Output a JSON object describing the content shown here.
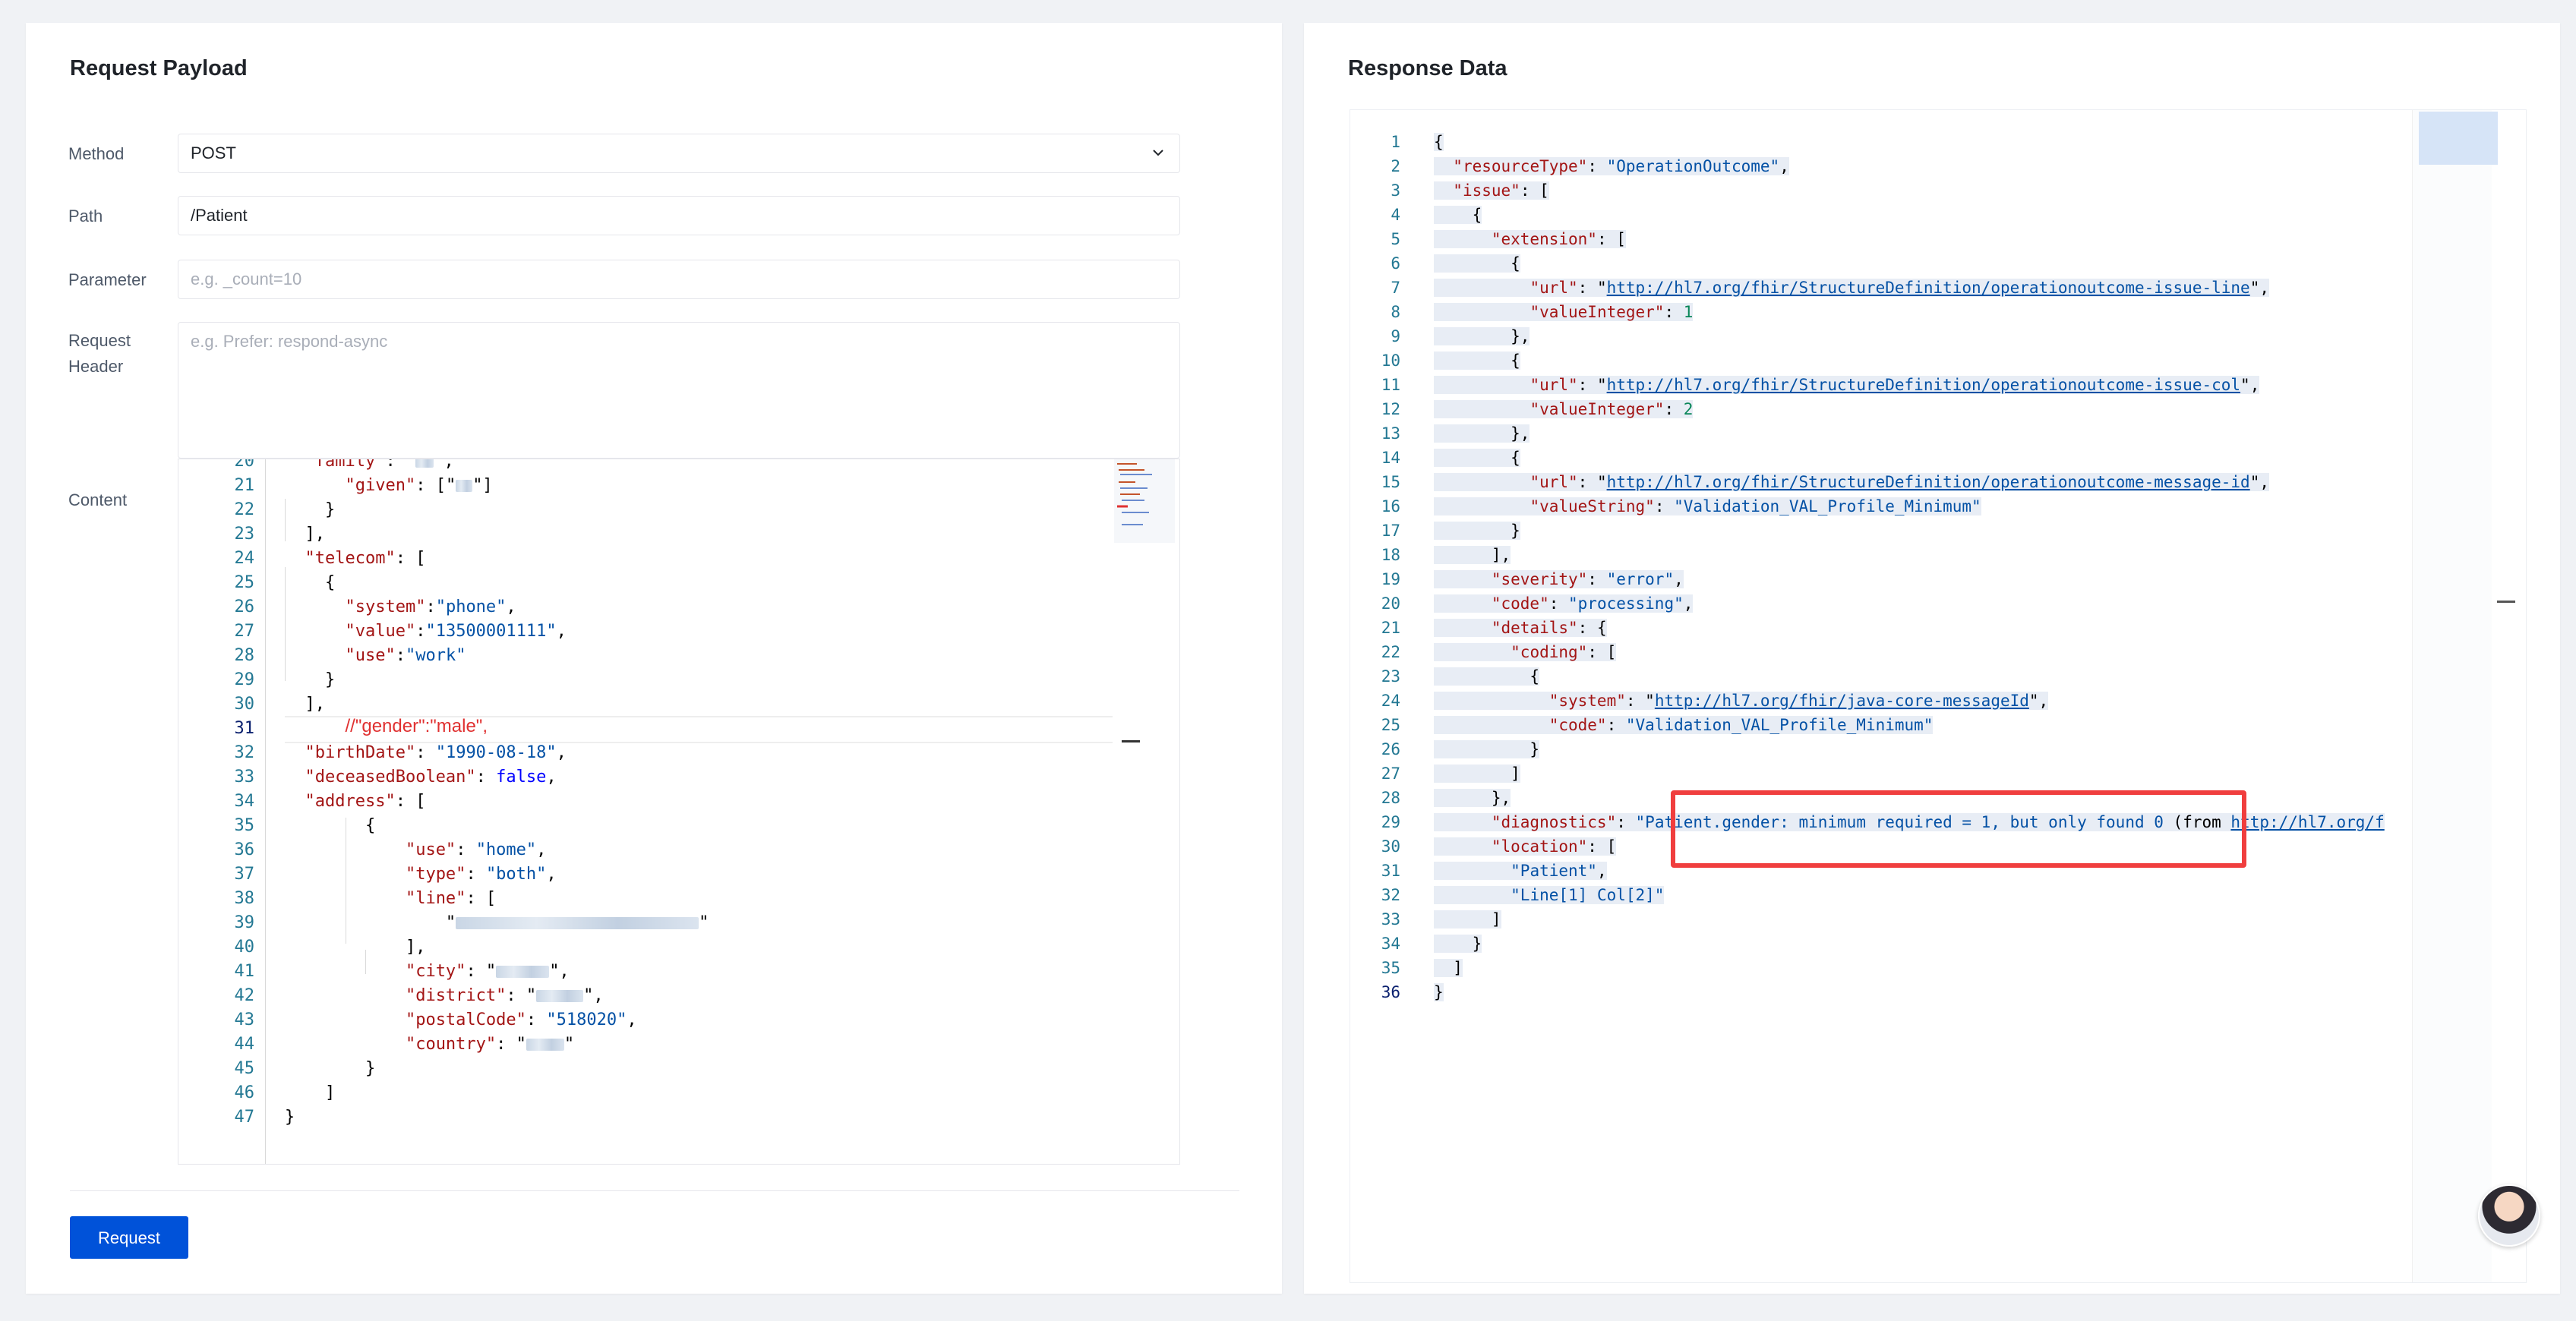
{
  "left": {
    "title": "Request Payload",
    "method_label": "Method",
    "method_value": "POST",
    "path_label": "Path",
    "path_value": "/Patient",
    "parameter_label": "Parameter",
    "parameter_placeholder": "e.g. _count=10",
    "header_label_1": "Request",
    "header_label_2": "Header",
    "header_placeholder": "e.g. Prefer: respond-async",
    "content_label": "Content",
    "request_button": "Request"
  },
  "right": {
    "title": "Response Data"
  },
  "left_code": [
    {
      "n": "20",
      "t": "  \"family\": \"██\","
    },
    {
      "n": "21",
      "t": "given"
    },
    {
      "n": "22"
    },
    {
      "n": "23"
    },
    {
      "n": "24"
    },
    {
      "n": "25"
    },
    {
      "n": "26"
    },
    {
      "n": "27"
    },
    {
      "n": "28"
    },
    {
      "n": "29"
    },
    {
      "n": "30"
    },
    {
      "n": "31"
    },
    {
      "n": "32"
    },
    {
      "n": "33"
    },
    {
      "n": "34"
    },
    {
      "n": "35"
    },
    {
      "n": "36"
    },
    {
      "n": "37"
    },
    {
      "n": "38"
    },
    {
      "n": "39"
    },
    {
      "n": "40"
    },
    {
      "n": "41"
    },
    {
      "n": "42"
    },
    {
      "n": "43"
    },
    {
      "n": "44"
    },
    {
      "n": "45"
    },
    {
      "n": "46"
    },
    {
      "n": "47"
    }
  ],
  "left_strings": {
    "given": "\"given\"",
    "telecom": "\"telecom\"",
    "system": "\"system\"",
    "phone": "\"phone\"",
    "value": "\"value\"",
    "phone_no": "\"13500001111\"",
    "use": "\"use\"",
    "work": "\"work\"",
    "gender_comment": "//\"gender\":\"male\",",
    "birthDate": "\"birthDate\"",
    "birth_val": "\"1990-08-18\"",
    "deceased": "\"deceasedBoolean\"",
    "false": "false",
    "address": "\"address\"",
    "home": "\"home\"",
    "type": "\"type\"",
    "both": "\"both\"",
    "line": "\"line\"",
    "city": "\"city\"",
    "district": "\"district\"",
    "postalCode": "\"postalCode\"",
    "postal_val": "\"518020\"",
    "country": "\"country\""
  },
  "right_code": {
    "resourceType_key": "\"resourceType\"",
    "resourceType_val": "\"OperationOutcome\"",
    "issue_key": "\"issue\"",
    "extension_key": "\"extension\"",
    "url_key": "\"url\"",
    "url1": "http://hl7.org/fhir/StructureDefinition/operationoutcome-issue-line",
    "valueInteger_key": "\"valueInteger\"",
    "vi1": "1",
    "url2": "http://hl7.org/fhir/StructureDefinition/operationoutcome-issue-col",
    "vi2": "2",
    "url3": "http://hl7.org/fhir/StructureDefinition/operationoutcome-message-id",
    "valueString_key": "\"valueString\"",
    "vs": "\"Validation_VAL_Profile_Minimum\"",
    "severity_key": "\"severity\"",
    "severity_val": "\"error\"",
    "code_key": "\"code\"",
    "code_val": "\"processing\"",
    "details_key": "\"details\"",
    "coding_key": "\"coding\"",
    "system_key": "\"system\"",
    "system_val": "http://hl7.org/fhir/java-core-messageId",
    "code_key2": "\"code\"",
    "code_val2": "\"Validation_VAL_Profile_Minimum\"",
    "diagnostics_key": "\"diagnostics\"",
    "diagnostics_val": "\"Patient.gender: minimum required = 1, but only found 0",
    "diagnostics_tail": " (from ",
    "diagnostics_link": "http://hl7.org/f",
    "location_key": "\"location\"",
    "loc1": "\"Patient\"",
    "loc2": "\"Line[1] Col[2]\""
  },
  "right_line_numbers": [
    "1",
    "2",
    "3",
    "4",
    "5",
    "6",
    "7",
    "8",
    "9",
    "10",
    "11",
    "12",
    "13",
    "14",
    "15",
    "16",
    "17",
    "18",
    "19",
    "20",
    "21",
    "22",
    "23",
    "24",
    "25",
    "26",
    "27",
    "28",
    "29",
    "30",
    "31",
    "32",
    "33",
    "34",
    "35",
    "36"
  ]
}
